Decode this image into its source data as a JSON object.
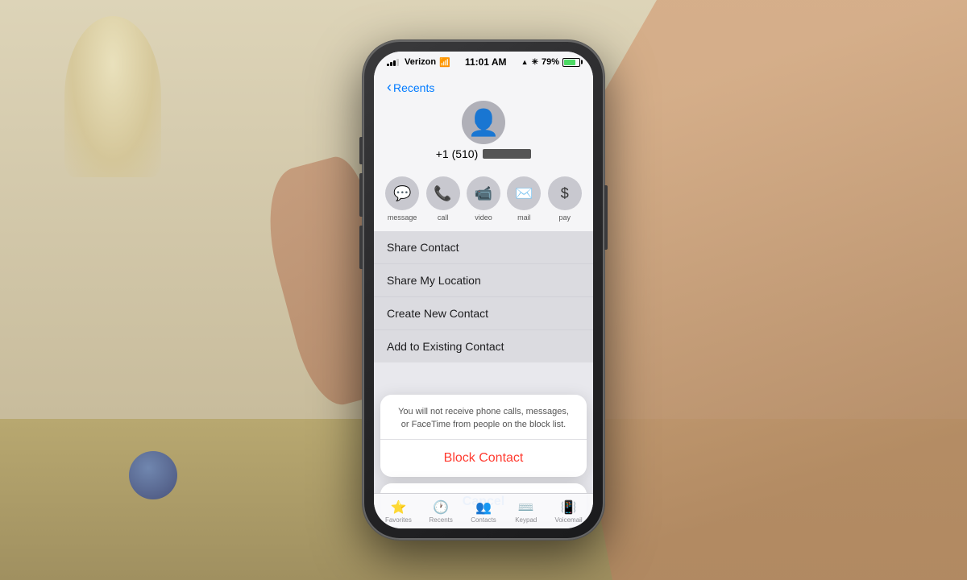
{
  "background": {
    "color": "#c8b89a"
  },
  "phone": {
    "status_bar": {
      "carrier": "Verizon",
      "time": "11:01 AM",
      "battery_percent": "79%",
      "wifi_icon": "wifi",
      "location_icon": "location",
      "bluetooth_icon": "bluetooth"
    },
    "contact_header": {
      "back_label": "Recents",
      "phone_number": "+1 (510)",
      "avatar_placeholder": "👤"
    },
    "action_buttons": [
      {
        "icon": "💬",
        "label": "message"
      },
      {
        "icon": "📞",
        "label": "call"
      },
      {
        "icon": "📹",
        "label": "video"
      },
      {
        "icon": "✉️",
        "label": "mail"
      },
      {
        "icon": "💰",
        "label": "pay"
      }
    ],
    "menu_items": [
      {
        "label": "Share Contact"
      },
      {
        "label": "Share My Location"
      },
      {
        "label": "Create New Contact"
      },
      {
        "label": "Add to Existing Contact"
      }
    ],
    "action_sheet": {
      "message": "You will not receive phone calls, messages, or FaceTime from people on the block list.",
      "block_label": "Block Contact",
      "cancel_label": "Cancel"
    },
    "tab_bar": [
      {
        "icon": "⭐",
        "label": "Favorites"
      },
      {
        "icon": "🕐",
        "label": "Recents"
      },
      {
        "icon": "👥",
        "label": "Contacts"
      },
      {
        "icon": "⌨️",
        "label": "Keypad"
      },
      {
        "icon": "📳",
        "label": "Voicemail"
      }
    ]
  }
}
